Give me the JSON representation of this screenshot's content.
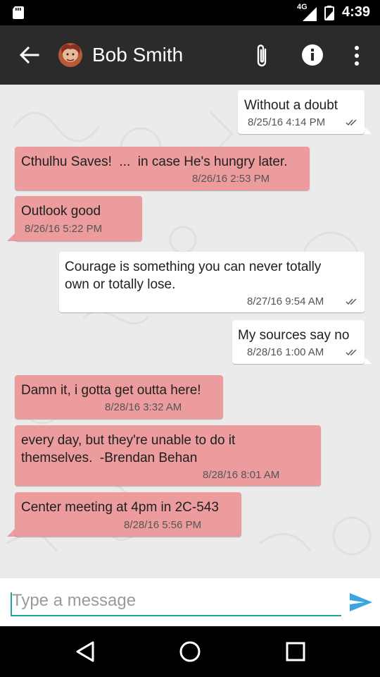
{
  "status_bar": {
    "time": "4:39",
    "network": "4G",
    "icons": [
      "sd-card-icon",
      "signal-icon",
      "battery-icon"
    ]
  },
  "app_bar": {
    "contact_name": "Bob Smith",
    "icons": [
      "back-arrow-icon",
      "avatar",
      "attach-icon",
      "info-icon",
      "more-vert-icon"
    ]
  },
  "messages": [
    {
      "direction": "out",
      "text": "Without a doubt",
      "time": "8/25/16 4:14 PM",
      "status": "double-check"
    },
    {
      "direction": "in",
      "text": "Cthulhu Saves!  ...  in case He's hungry later.",
      "time": "8/26/16 2:53 PM"
    },
    {
      "direction": "in",
      "text": "Outlook good",
      "time": "8/26/16 5:22 PM"
    },
    {
      "direction": "out",
      "text": "Courage is something you can never totally\nown or totally lose.",
      "time": "8/27/16 9:54 AM",
      "status": "double-check"
    },
    {
      "direction": "out",
      "text": "My sources say no",
      "time": "8/28/16 1:00 AM",
      "status": "double-check"
    },
    {
      "direction": "in",
      "text": "Damn it, i gotta get outta here!",
      "time": "8/28/16 3:32 AM"
    },
    {
      "direction": "in",
      "text": "every day, but they're unable to do it\nthemselves.  -Brendan Behan",
      "time": "8/28/16 8:01 AM"
    },
    {
      "direction": "in",
      "text": "Center meeting at 4pm in 2C-543",
      "time": "8/28/16 5:56 PM"
    }
  ],
  "composer": {
    "placeholder": "Type a message",
    "value": ""
  },
  "nav_bar": {
    "icons": [
      "back-triangle-icon",
      "home-circle-icon",
      "recents-square-icon"
    ]
  },
  "colors": {
    "incoming_bubble": "#ec9c9c",
    "outgoing_bubble": "#ffffff",
    "app_bar": "#2b2b2b",
    "chat_background": "#ebebeb",
    "accent": "#1f9fa6",
    "send": "#3aa5e0"
  }
}
